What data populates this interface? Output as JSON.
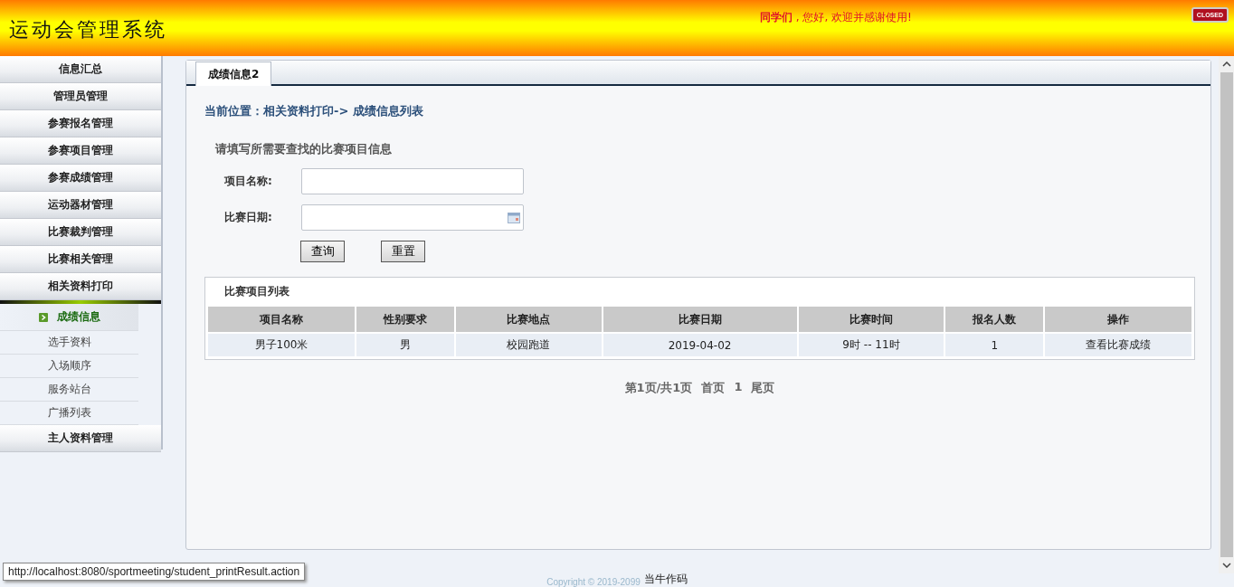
{
  "header": {
    "title": "运动会管理系统",
    "greeting": "**同学们** , 您好, 欢迎并感谢使用!",
    "close_label": "CLOSED"
  },
  "sidebar": {
    "items": [
      {
        "label": "信息汇总"
      },
      {
        "label": "管理员管理"
      },
      {
        "label": "参赛报名管理"
      },
      {
        "label": "参赛项目管理"
      },
      {
        "label": "参赛成绩管理"
      },
      {
        "label": "运动器材管理"
      },
      {
        "label": "比赛裁判管理"
      },
      {
        "label": "比赛相关管理"
      },
      {
        "label": "相关资料打印",
        "children": [
          {
            "label": "成绩信息",
            "selected": true
          },
          {
            "label": "选手资料",
            "selected": false
          },
          {
            "label": "入场顺序",
            "selected": false
          },
          {
            "label": "服务站台",
            "selected": false
          },
          {
            "label": "广播列表",
            "selected": false
          }
        ]
      },
      {
        "label": "主人资料管理"
      }
    ]
  },
  "tabs": [
    {
      "label": "成绩信息2",
      "selected": true
    }
  ],
  "breadcrumb": "当前位置：相关资料打印-> 成绩信息列表",
  "search": {
    "heading": "请填写所需要查找的比赛项目信息",
    "fields": [
      {
        "label": "项目名称:",
        "kind": "text"
      },
      {
        "label": "比赛日期:",
        "kind": "date"
      }
    ],
    "buttons": [
      "查询",
      "重置"
    ]
  },
  "table": {
    "title": "比赛项目列表",
    "columns": [
      "项目名称",
      "性别要求",
      "比赛地点",
      "比赛日期",
      "比赛时间",
      "报名人数",
      "操作"
    ],
    "rows": [
      [
        "男子100米",
        "男",
        "校园跑道",
        "2019-04-02",
        "9时 -- 11时",
        "1",
        "查看比赛成绩"
      ]
    ]
  },
  "pagination": {
    "summary": "第1页/共1页",
    "first": "首页",
    "page": "1",
    "last": "尾页"
  },
  "footer": {
    "copyright": "Copyright © 2019-2099",
    "author": "当牛作码"
  },
  "status_url": "http://localhost:8080/sportmeeting/student_printResult.action"
}
